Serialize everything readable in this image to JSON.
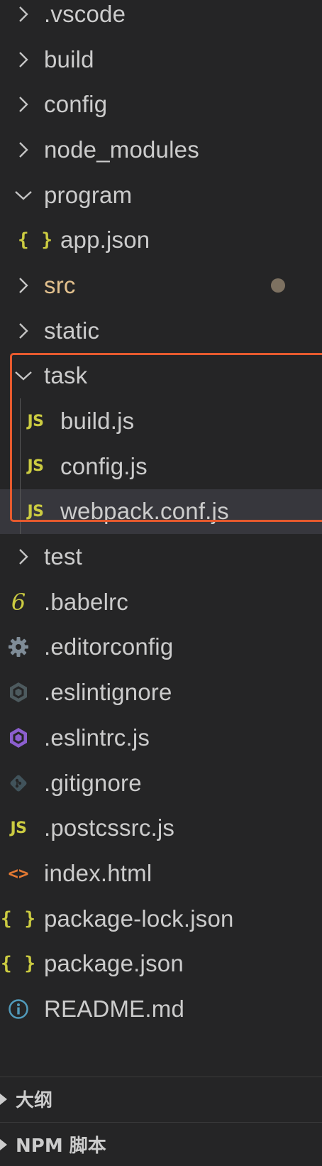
{
  "explorer": {
    "folders_top": [
      {
        "label": ".vscode",
        "expanded": false
      },
      {
        "label": "build",
        "expanded": false
      },
      {
        "label": "config",
        "expanded": false
      },
      {
        "label": "node_modules",
        "expanded": false
      }
    ],
    "program": {
      "label": "program",
      "expanded": true,
      "children": [
        {
          "label": "app.json",
          "icon": "json-braces-icon"
        }
      ]
    },
    "src": {
      "label": "src",
      "expanded": false,
      "status": "modified"
    },
    "static": {
      "label": "static",
      "expanded": false
    },
    "task": {
      "label": "task",
      "expanded": true,
      "children": [
        {
          "label": "build.js",
          "icon": "js-icon"
        },
        {
          "label": "config.js",
          "icon": "js-icon"
        },
        {
          "label": "webpack.conf.js",
          "icon": "js-icon",
          "selected": true
        }
      ]
    },
    "test": {
      "label": "test",
      "expanded": false
    },
    "root_files": [
      {
        "label": ".babelrc",
        "icon": "babel-icon"
      },
      {
        "label": ".editorconfig",
        "icon": "gear-icon"
      },
      {
        "label": ".eslintignore",
        "icon": "eslint-outline-icon"
      },
      {
        "label": ".eslintrc.js",
        "icon": "eslint-icon"
      },
      {
        "label": ".gitignore",
        "icon": "git-icon"
      },
      {
        "label": ".postcssrc.js",
        "icon": "js-icon"
      },
      {
        "label": "index.html",
        "icon": "html-icon"
      },
      {
        "label": "package-lock.json",
        "icon": "json-braces-icon"
      },
      {
        "label": "package.json",
        "icon": "json-braces-icon"
      },
      {
        "label": "README.md",
        "icon": "info-icon"
      }
    ]
  },
  "icons": {
    "js": "JS",
    "braces": "{ }",
    "babel": "6",
    "html": "<>"
  },
  "panels": {
    "outline": "大纲",
    "npm_scripts": "NPM 脚本"
  },
  "colors": {
    "background": "#252526",
    "text": "#cccccc",
    "modified_text": "#e2c08d",
    "selected_row": "#37373d",
    "highlight_border": "#e65a2e",
    "js_yellow": "#cbcb41",
    "html_orange": "#e37933",
    "eslint_purple": "#8c5fcf",
    "info_blue": "#519aba"
  }
}
